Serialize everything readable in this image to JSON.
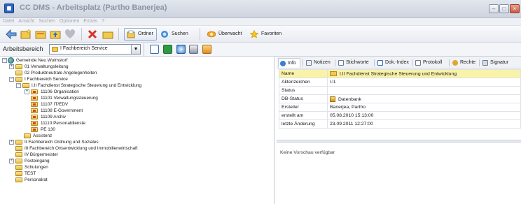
{
  "window": {
    "title": "CC DMS - Arbeitsplatz (Partho Banerjea)"
  },
  "menu": [
    "Datei",
    "Ansicht",
    "Suchen",
    "Optionen",
    "Extras",
    "?"
  ],
  "toolbar": {
    "ordner": "Ordner",
    "suchen": "Suchen",
    "ueberwacht": "Überwacht",
    "favoriten": "Favoriten"
  },
  "arbeitsbereich": {
    "label": "Arbeitsbereich",
    "value": "I Fachbereich Service"
  },
  "tree": [
    {
      "label": "Gemeinde Neu Wulmstorf",
      "level": 0,
      "expander": "-",
      "icon": "globe"
    },
    {
      "label": "01 Verwaltungsleitung",
      "level": 1,
      "expander": "+",
      "icon": "folder"
    },
    {
      "label": "02 Produktneutrale Angelegenheiten",
      "level": 1,
      "expander": "",
      "icon": "folder"
    },
    {
      "label": "I Fachbereich Service",
      "level": 1,
      "expander": "-",
      "icon": "folder"
    },
    {
      "label": "I.II Fachdienst Strategische Steuerung und Entwicklung",
      "level": 2,
      "expander": "-",
      "icon": "folder"
    },
    {
      "label": "11106 Organisation",
      "level": 3,
      "expander": "+",
      "icon": "folder-red"
    },
    {
      "label": "11101 Verwaltungssteuerung",
      "level": 3,
      "expander": "",
      "icon": "folder-red"
    },
    {
      "label": "11107 IT/EDV",
      "level": 3,
      "expander": "",
      "icon": "folder-red"
    },
    {
      "label": "11108 E-Government",
      "level": 3,
      "expander": "",
      "icon": "folder-red"
    },
    {
      "label": "11109 Archiv",
      "level": 3,
      "expander": "",
      "icon": "folder-red"
    },
    {
      "label": "11110 Personaldienste",
      "level": 3,
      "expander": "",
      "icon": "folder-red"
    },
    {
      "label": "PE 130",
      "level": 3,
      "expander": "",
      "icon": "folder-red"
    },
    {
      "label": "Assistenz",
      "level": 2,
      "expander": "",
      "icon": "folder"
    },
    {
      "label": "II Fachbereich Ordnung und Soziales",
      "level": 1,
      "expander": "+",
      "icon": "folder"
    },
    {
      "label": "III Fachbereich Ortsentwicklung und Immobilienwirtschaft",
      "level": 1,
      "expander": "",
      "icon": "folder"
    },
    {
      "label": "IV Bürgermeister",
      "level": 1,
      "expander": "",
      "icon": "folder"
    },
    {
      "label": "Posteingang",
      "level": 1,
      "expander": "+",
      "icon": "folder"
    },
    {
      "label": "Schulungen",
      "level": 1,
      "expander": "",
      "icon": "folder"
    },
    {
      "label": "TEST",
      "level": 1,
      "expander": "",
      "icon": "folder"
    },
    {
      "label": "Personalrat",
      "level": 1,
      "expander": "",
      "icon": "folder"
    }
  ],
  "tabs": [
    "Info",
    "Notizen",
    "Stichworte",
    "Dok.-Index",
    "Protokoll",
    "Rechte",
    "Signatur"
  ],
  "properties": [
    {
      "key": "Name",
      "value": "I.II Fachdienst Strategische Steuerung und Entwicklung",
      "icon": "folder",
      "selected": true
    },
    {
      "key": "Aktenzeichen",
      "value": "I.II.",
      "icon": "",
      "selected": false
    },
    {
      "key": "Status",
      "value": "",
      "icon": "",
      "selected": false
    },
    {
      "key": "DB-Status",
      "value": "Datenbank",
      "icon": "db",
      "selected": false
    },
    {
      "key": "Ersteller",
      "value": "Banerjea, Partho",
      "icon": "",
      "selected": false
    },
    {
      "key": "erstellt am",
      "value": "05.08.2010 15:13:00",
      "icon": "",
      "selected": false
    },
    {
      "key": "letzte Änderung",
      "value": "23.09.2011 12:27:00",
      "icon": "",
      "selected": false
    }
  ],
  "preview": {
    "text": "Keine Vorschau verfügbar"
  }
}
